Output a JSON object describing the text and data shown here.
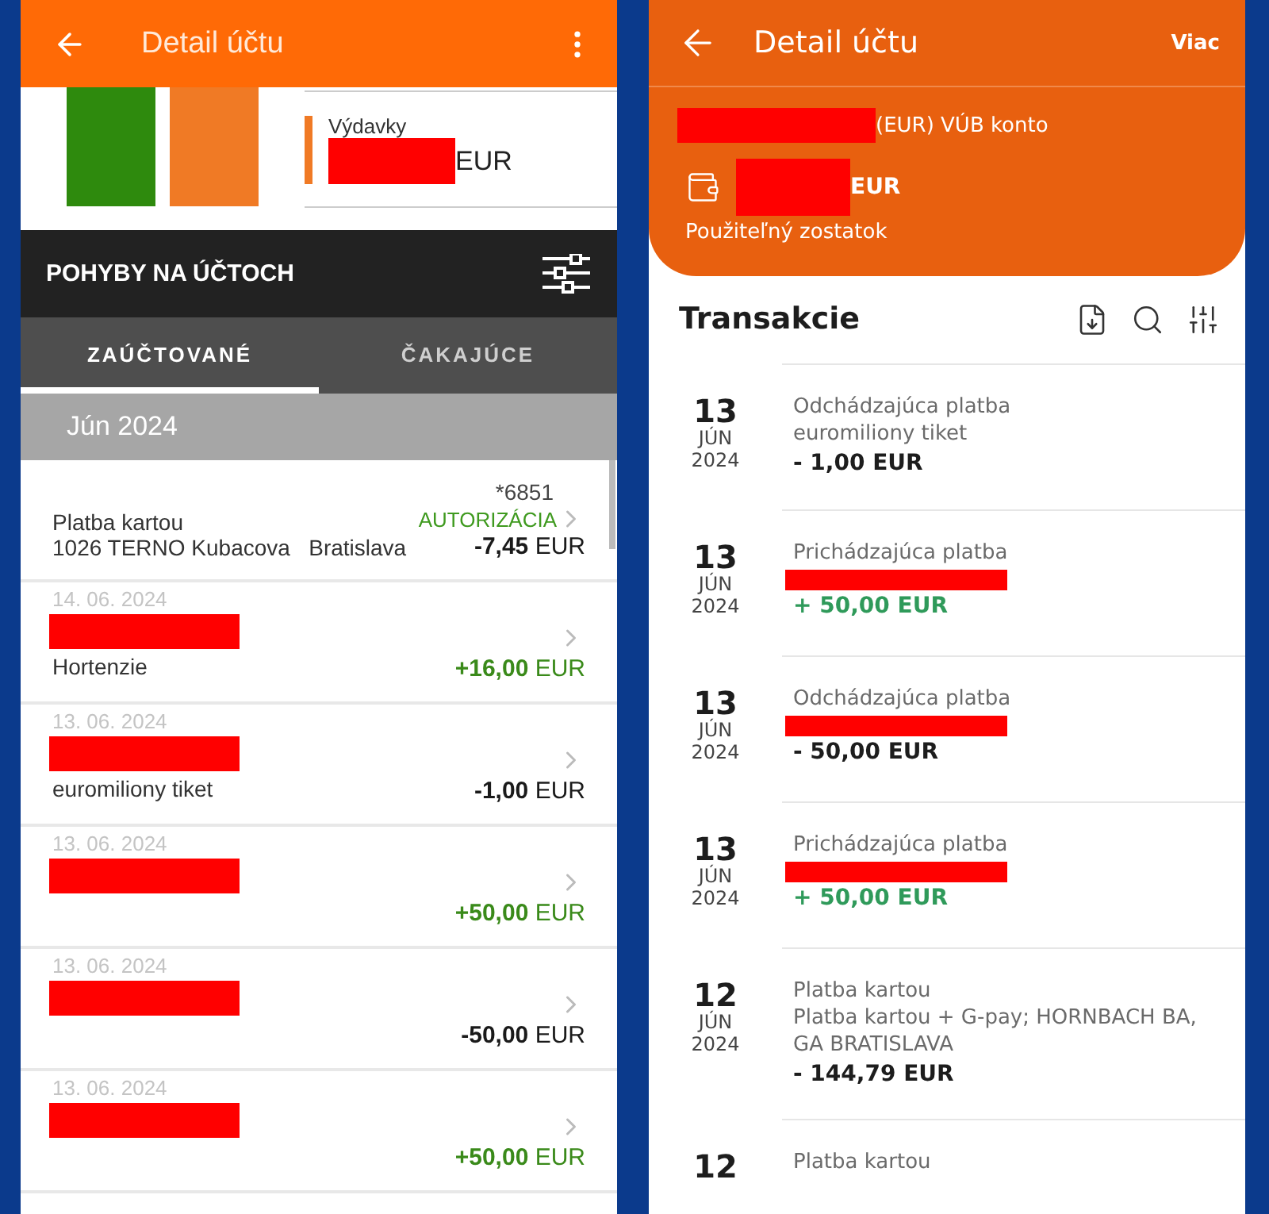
{
  "left_screen": {
    "title": "Detail účtu",
    "summary": {
      "label": "Výdavky",
      "amount_redacted": true,
      "currency": "EUR"
    },
    "section_title": "POHYBY NA ÚČTOCH",
    "tabs": [
      {
        "label": "ZAÚČTOVANÉ",
        "selected": true
      },
      {
        "label": "ČAKAJÚCE",
        "selected": false
      }
    ],
    "month": "Jún 2024",
    "transactions": [
      {
        "kind": "card",
        "card": "*6851",
        "title": "Platba kartou",
        "status": "AUTORIZÁCIA",
        "merchant": "1026 TERNO Kubacova   Bratislava",
        "amount": "**-7,45** EUR",
        "positive": false
      },
      {
        "kind": "transfer",
        "date": "14. 06. 2024",
        "redacted": true,
        "description": "Hortenzie",
        "amount": "**+16,00** EUR",
        "positive": true
      },
      {
        "kind": "transfer",
        "date": "13. 06. 2024",
        "redacted": true,
        "description": "euromiliony tiket",
        "amount": "**-1,00** EUR",
        "positive": false
      },
      {
        "kind": "transfer",
        "date": "13. 06. 2024",
        "redacted": true,
        "amount": "**+50,00** EUR",
        "positive": true
      },
      {
        "kind": "transfer",
        "date": "13. 06. 2024",
        "redacted": true,
        "amount": "**-50,00** EUR",
        "positive": false
      },
      {
        "kind": "transfer",
        "date": "13. 06. 2024",
        "redacted": true,
        "amount": "**+50,00** EUR",
        "positive": true
      }
    ]
  },
  "right_screen": {
    "title": "Detail účtu",
    "more": "Viac",
    "account": {
      "number_redacted": true,
      "name": "(EUR) VÚB konto",
      "balance_redacted": true,
      "currency": "EUR",
      "balance_label": "Použiteľný zostatok"
    },
    "section_title": "Transakcie",
    "transactions": [
      {
        "day": "13",
        "month": "JÚN",
        "year": "2024",
        "type": "Odchádzajúca platba",
        "description": "euromiliony tiket",
        "amount": "- 1,00 EUR",
        "positive": false
      },
      {
        "day": "13",
        "month": "JÚN",
        "year": "2024",
        "type": "Prichádzajúca platba",
        "redacted": true,
        "amount": "+ 50,00 EUR",
        "positive": true
      },
      {
        "day": "13",
        "month": "JÚN",
        "year": "2024",
        "type": "Odchádzajúca platba",
        "redacted": true,
        "amount": "- 50,00 EUR",
        "positive": false
      },
      {
        "day": "13",
        "month": "JÚN",
        "year": "2024",
        "type": "Prichádzajúca platba",
        "redacted": true,
        "amount": "+ 50,00 EUR",
        "positive": true
      },
      {
        "day": "12",
        "month": "JÚN",
        "year": "2024",
        "type": "Platba kartou",
        "description": "Platba kartou + G-pay; HORNBACH BA, GA  BRATISLAVA",
        "amount": "- 144,79 EUR",
        "positive": false
      },
      {
        "day": "12",
        "type": "Platba kartou"
      }
    ]
  }
}
